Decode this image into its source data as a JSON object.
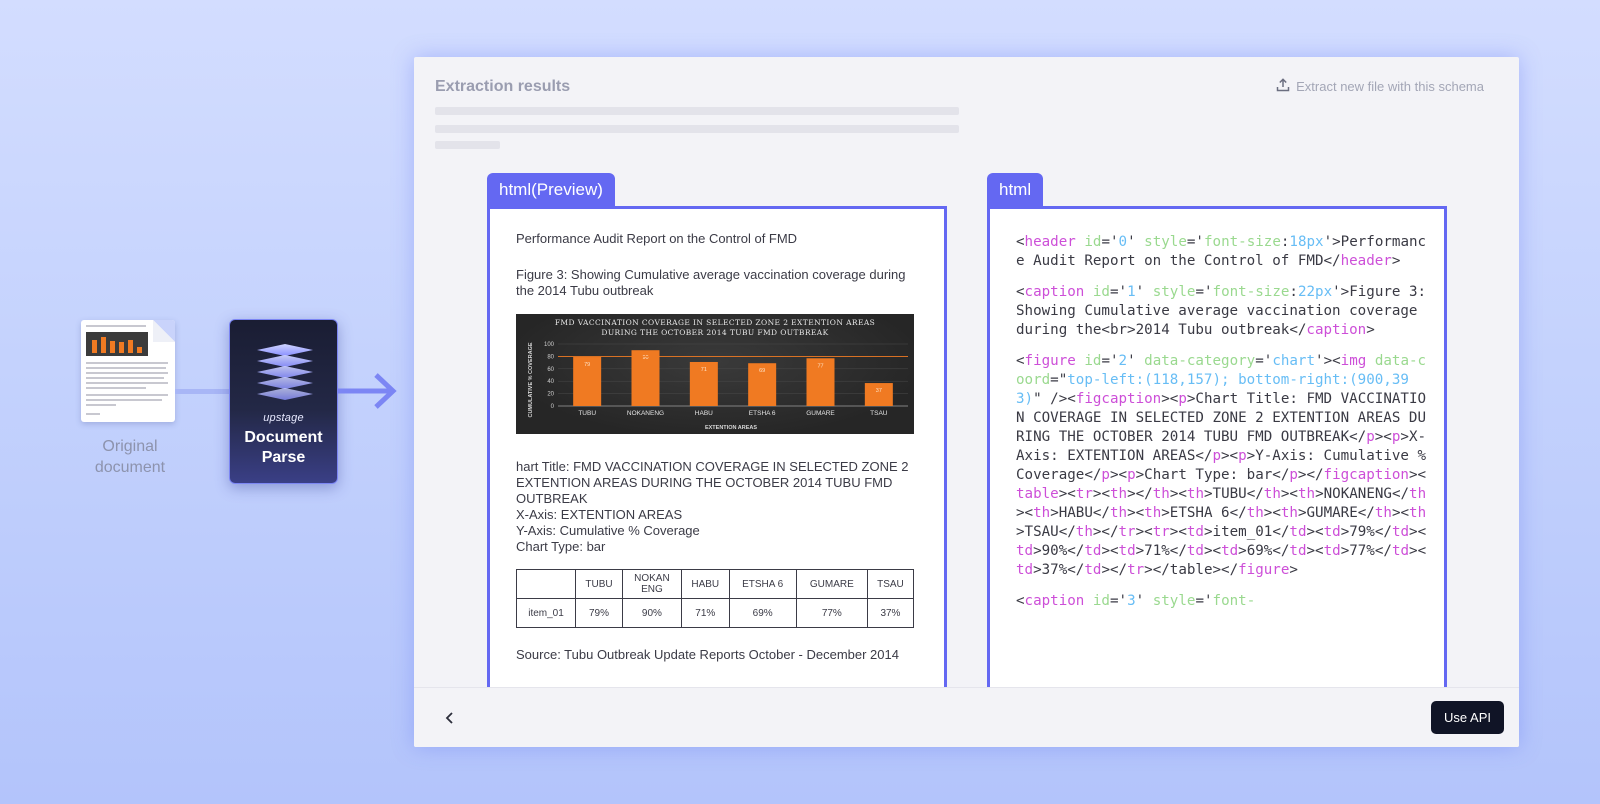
{
  "left": {
    "original_label": "Original document",
    "parse_card": {
      "brand": "upstage",
      "title": "Document Parse"
    }
  },
  "panel": {
    "title": "Extraction results",
    "extract_link": "Extract new file with this schema",
    "tabs": {
      "preview": "html(Preview)",
      "code": "html"
    },
    "preview": {
      "header": "Performance Audit Report on the Control of FMD",
      "caption_line1": "Figure 3: Showing Cumulative average vaccination coverage during",
      "caption_line2": "the 2014 Tubu outbreak",
      "desc_line1": "hart Title: FMD VACCINATION COVERAGE IN SELECTED ZONE 2",
      "desc_line2": "EXTENTION AREAS DURING THE OCTOBER 2014 TUBU FMD",
      "desc_line3": "OUTBREAK",
      "desc_xaxis": "X-Axis: EXTENTION AREAS",
      "desc_yaxis": "Y-Axis: Cumulative % Coverage",
      "desc_type": "Chart Type: bar",
      "table": {
        "headers": [
          "TUBU",
          "NOKANENG",
          "HABU",
          "ETSHA 6",
          "GUMARE",
          "TSAU"
        ],
        "row_label": "item_01",
        "row_values": [
          "79%",
          "90%",
          "71%",
          "69%",
          "77%",
          "37%"
        ]
      },
      "source": "Source: Tubu Outbreak Update Reports October - December 2014"
    },
    "footer": {
      "api_button": "Use API"
    }
  },
  "chart_data": {
    "type": "bar",
    "title": "FMD VACCINATION COVERAGE IN SELECTED ZONE 2 EXTENTION AREAS DURING THE OCTOBER 2014 TUBU FMD OUTBREAK",
    "title_line1": "FMD VACCINATION COVERAGE IN SELECTED ZONE 2 EXTENTION AREAS",
    "title_line2": "DURING THE OCTOBER 2014 TUBU FMD OUTBREAK",
    "xlabel": "EXTENTION AREAS",
    "ylabel": "CUMULATIVE % COVERAGE",
    "categories": [
      "TUBU",
      "NOKANENG",
      "HABU",
      "ETSHA 6",
      "GUMARE",
      "TSAU"
    ],
    "values": [
      79,
      90,
      71,
      69,
      77,
      37
    ],
    "data_labels": [
      "79",
      "90",
      "71",
      "69",
      "77",
      "37"
    ],
    "yticks": [
      "0",
      "20",
      "40",
      "60",
      "80",
      "100"
    ],
    "ylim": [
      0,
      100
    ],
    "reference_line": 80,
    "bar_color": "#f07a22",
    "background": "#2b2b2b"
  }
}
